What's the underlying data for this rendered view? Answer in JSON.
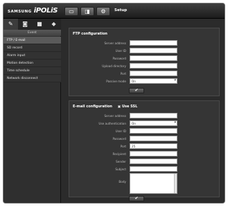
{
  "header": {
    "brand": "SAMSUNG",
    "product": "iPOLiS",
    "buttons": [
      {
        "icon": "monitor-icon",
        "glyph": "▭"
      },
      {
        "icon": "playback-icon",
        "glyph": "◨"
      },
      {
        "icon": "gear-icon",
        "glyph": "⚙"
      }
    ],
    "section_title": "Setup"
  },
  "sidebar": {
    "tabs": [
      {
        "icon": "wrench-icon",
        "glyph": "✎"
      },
      {
        "icon": "document-icon",
        "glyph": "◙"
      },
      {
        "icon": "lock-icon",
        "glyph": "■"
      },
      {
        "icon": "network-icon",
        "glyph": "◆"
      }
    ],
    "header": "Event",
    "items": [
      {
        "label": "FTP / E-mail",
        "active": true
      },
      {
        "label": "SD record",
        "active": false
      },
      {
        "label": "Alarm input",
        "active": false
      },
      {
        "label": "Motion detection",
        "active": false
      },
      {
        "label": "Time schedule",
        "active": false
      },
      {
        "label": "Network disconnect",
        "active": false
      }
    ]
  },
  "ftp": {
    "title": "FTP configuration",
    "fields": [
      {
        "label": "Server address",
        "value": "",
        "type": "text"
      },
      {
        "label": "User ID",
        "value": "",
        "type": "text"
      },
      {
        "label": "Password",
        "value": "",
        "type": "text"
      },
      {
        "label": "Upload directory",
        "value": "",
        "type": "text"
      },
      {
        "label": "Port",
        "value": "",
        "type": "text"
      },
      {
        "label": "Passive mode",
        "value": "On",
        "type": "select"
      }
    ],
    "apply_label": "✔"
  },
  "mail": {
    "title": "E-mail configuration",
    "use_ssl_label": "Use SSL",
    "fields": [
      {
        "label": "Server address",
        "value": "",
        "type": "text"
      },
      {
        "label": "Use authentication",
        "value": "On",
        "type": "select"
      },
      {
        "label": "User ID",
        "value": "",
        "type": "text"
      },
      {
        "label": "Password",
        "value": "",
        "type": "text"
      },
      {
        "label": "Port",
        "value": "25",
        "type": "text"
      },
      {
        "label": "Recipient",
        "value": "",
        "type": "text"
      },
      {
        "label": "Sender",
        "value": "",
        "type": "text"
      },
      {
        "label": "Subject",
        "value": "",
        "type": "text"
      }
    ],
    "body_label": "Body",
    "apply_label": "✔"
  }
}
